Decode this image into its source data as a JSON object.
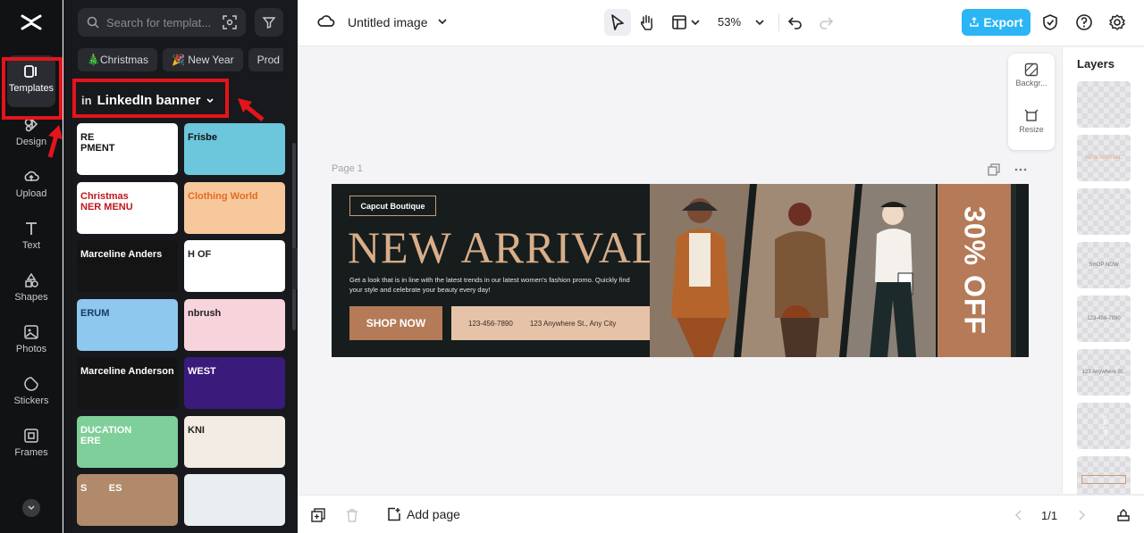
{
  "app": {
    "logo": "capcut-logo"
  },
  "rail": {
    "items": [
      {
        "label": "Templates",
        "icon": "templates-icon"
      },
      {
        "label": "Design",
        "icon": "design-icon"
      },
      {
        "label": "Upload",
        "icon": "upload-icon"
      },
      {
        "label": "Text",
        "icon": "text-icon"
      },
      {
        "label": "Shapes",
        "icon": "shapes-icon"
      },
      {
        "label": "Photos",
        "icon": "photos-icon"
      },
      {
        "label": "Stickers",
        "icon": "stickers-icon"
      },
      {
        "label": "Frames",
        "icon": "frames-icon"
      }
    ]
  },
  "panel": {
    "search_placeholder": "Search for templat...",
    "chips": [
      "🎄Christmas",
      "🎉 New Year",
      "Prod"
    ],
    "category_prefix": "in",
    "category": "LinkedIn banner",
    "thumbs": [
      {
        "text": "RE\nPMENT",
        "bg": "#ffffff",
        "fg": "#111111"
      },
      {
        "text": "Frisbe",
        "bg": "#6cc7dc",
        "fg": "#111111"
      },
      {
        "text": "Christmas\nNER MENU",
        "bg": "#ffffff",
        "fg": "#c0161d"
      },
      {
        "text": "Clothing World",
        "bg": "#f6c89b",
        "fg": "#e46a23"
      },
      {
        "text": "Marceline Anders",
        "bg": "#141414",
        "fg": "#ffffff"
      },
      {
        "text": "H OF",
        "bg": "#ffffff",
        "fg": "#222222"
      },
      {
        "text": "ERUM",
        "bg": "#8ec8ef",
        "fg": "#173a6a"
      },
      {
        "text": "nbrush",
        "bg": "#f7d3dc",
        "fg": "#222222"
      },
      {
        "text": "Marceline Anderson",
        "bg": "#141414",
        "fg": "#ffffff"
      },
      {
        "text": "WEST",
        "bg": "#3a1a7a",
        "fg": "#ffffff"
      },
      {
        "text": "DUCATION\nERE",
        "bg": "#7fcf9a",
        "fg": "#ffffff"
      },
      {
        "text": "KNI",
        "bg": "#f3ece4",
        "fg": "#222222"
      },
      {
        "text": "S        ES",
        "bg": "#b08a6a",
        "fg": "#ffffff"
      },
      {
        "text": "",
        "bg": "#e9eef0",
        "fg": "#222222"
      }
    ]
  },
  "topbar": {
    "doc_title": "Untitled image",
    "zoom": "53%",
    "export_label": "Export"
  },
  "canvas": {
    "page_label": "Page 1",
    "banner": {
      "brand": "Capcut  Boutique",
      "headline": "NEW ARRIVAL",
      "description": "Get a look that is in line with the latest trends in our latest women's fashion promo. Quickly find your style and celebrate your beauty every day!",
      "cta": "SHOP NOW",
      "phone": "123-456-7890",
      "address": "123 Anywhere St., Any City",
      "offer": "30% OFF"
    },
    "float_tools": [
      "Backgr...",
      "Resize"
    ]
  },
  "layers": {
    "title": "Layers",
    "items": [
      "",
      "NEW ARRIVAL",
      "",
      "SHOP NOW",
      "123-456-7890",
      "123 Anywhere St.,",
      "30% OFF",
      ""
    ]
  },
  "bottombar": {
    "add_page": "Add page",
    "pager": "1/1"
  },
  "colors": {
    "accent": "#2bb5f5",
    "highlight": "#e3151b",
    "banner_bg": "#171d1c",
    "banner_accent": "#b57a58"
  }
}
